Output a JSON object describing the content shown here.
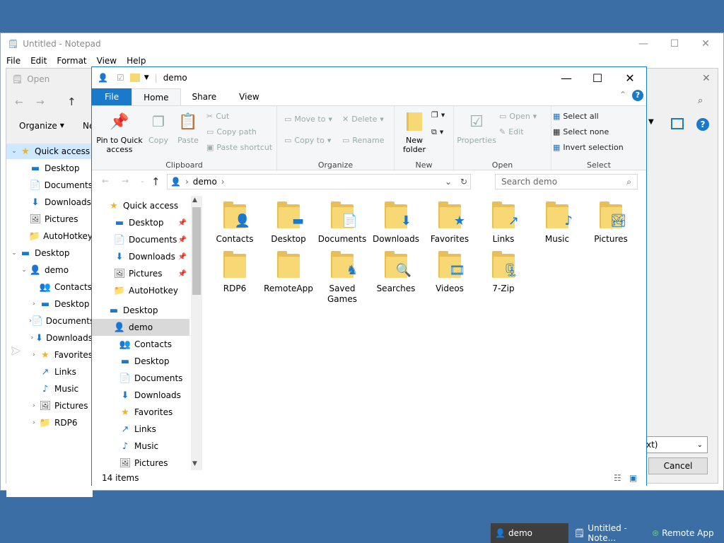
{
  "notepad": {
    "title": "Untitled - Notepad",
    "menu": [
      "File",
      "Edit",
      "Format",
      "View",
      "Help"
    ]
  },
  "open_dialog": {
    "title": "Open",
    "organize": "Organize",
    "new": "Ne",
    "file_type": "xt)",
    "cancel": "Cancel",
    "tree": [
      {
        "label": "Quick access",
        "icon": "star-icon",
        "level": 0,
        "expanded": true,
        "selected": true
      },
      {
        "label": "Desktop",
        "icon": "desktop-icon",
        "level": 1
      },
      {
        "label": "Documents",
        "icon": "documents-icon",
        "level": 1
      },
      {
        "label": "Downloads",
        "icon": "download-icon",
        "level": 1
      },
      {
        "label": "Pictures",
        "icon": "pictures-icon",
        "level": 1
      },
      {
        "label": "AutoHotkey",
        "icon": "folder-icon",
        "level": 1
      },
      {
        "label": "Desktop",
        "icon": "desktop-icon",
        "level": 0,
        "expanded": true
      },
      {
        "label": "demo",
        "icon": "user-icon",
        "level": 1,
        "expanded": true
      },
      {
        "label": "Contacts",
        "icon": "contacts-icon",
        "level": 2
      },
      {
        "label": "Desktop",
        "icon": "desktop-icon",
        "level": 2,
        "collapsed": true
      },
      {
        "label": "Documents",
        "icon": "documents-icon",
        "level": 2,
        "collapsed": true
      },
      {
        "label": "Downloads",
        "icon": "download-icon",
        "level": 2,
        "collapsed": true
      },
      {
        "label": "Favorites",
        "icon": "star-icon",
        "level": 2,
        "collapsed": true
      },
      {
        "label": "Links",
        "icon": "links-icon",
        "level": 2
      },
      {
        "label": "Music",
        "icon": "music-icon",
        "level": 2
      },
      {
        "label": "Pictures",
        "icon": "pictures-icon",
        "level": 2,
        "collapsed": true
      },
      {
        "label": "RDP6",
        "icon": "folder-icon",
        "level": 2,
        "collapsed": true
      }
    ]
  },
  "explorer": {
    "title": "demo",
    "tabs": [
      "File",
      "Home",
      "Share",
      "View"
    ],
    "ribbon": {
      "clipboard": {
        "label": "Clipboard",
        "pin": "Pin to Quick access",
        "copy": "Copy",
        "paste": "Paste",
        "cut": "Cut",
        "copy_path": "Copy path",
        "paste_shortcut": "Paste shortcut"
      },
      "organize": {
        "label": "Organize",
        "move_to": "Move to",
        "copy_to": "Copy to",
        "delete": "Delete",
        "rename": "Rename"
      },
      "new": {
        "label": "New",
        "new_folder": "New folder"
      },
      "open": {
        "label": "Open",
        "properties": "Properties",
        "open": "Open",
        "edit": "Edit"
      },
      "select": {
        "label": "Select",
        "select_all": "Select all",
        "select_none": "Select none",
        "invert": "Invert selection"
      }
    },
    "address": {
      "path": "demo",
      "search_placeholder": "Search demo"
    },
    "nav": [
      {
        "label": "Quick access",
        "icon": "star-icon",
        "level": 0
      },
      {
        "label": "Desktop",
        "icon": "desktop-icon",
        "level": 1,
        "pinned": true
      },
      {
        "label": "Documents",
        "icon": "documents-icon",
        "level": 1,
        "pinned": true
      },
      {
        "label": "Downloads",
        "icon": "download-icon",
        "level": 1,
        "pinned": true
      },
      {
        "label": "Pictures",
        "icon": "pictures-icon",
        "level": 1,
        "pinned": true
      },
      {
        "label": "AutoHotkey",
        "icon": "folder-icon",
        "level": 1
      },
      {
        "label": "Desktop",
        "icon": "desktop-icon",
        "level": 0
      },
      {
        "label": "demo",
        "icon": "user-icon",
        "level": 1,
        "selected": true
      },
      {
        "label": "Contacts",
        "icon": "contacts-icon",
        "level": 2
      },
      {
        "label": "Desktop",
        "icon": "desktop-icon",
        "level": 2
      },
      {
        "label": "Documents",
        "icon": "documents-icon",
        "level": 2
      },
      {
        "label": "Downloads",
        "icon": "download-icon",
        "level": 2
      },
      {
        "label": "Favorites",
        "icon": "star-icon",
        "level": 2
      },
      {
        "label": "Links",
        "icon": "links-icon",
        "level": 2
      },
      {
        "label": "Music",
        "icon": "music-icon",
        "level": 2
      },
      {
        "label": "Pictures",
        "icon": "pictures-icon",
        "level": 2
      }
    ],
    "items": [
      {
        "label": "Contacts",
        "badge": "👤",
        "icon": "contacts-folder-icon"
      },
      {
        "label": "Desktop",
        "badge": "▬",
        "icon": "desktop-folder-icon"
      },
      {
        "label": "Documents",
        "badge": "📄",
        "icon": "documents-folder-icon"
      },
      {
        "label": "Downloads",
        "badge": "⬇",
        "icon": "downloads-folder-icon"
      },
      {
        "label": "Favorites",
        "badge": "★",
        "icon": "favorites-folder-icon"
      },
      {
        "label": "Links",
        "badge": "↗",
        "icon": "links-folder-icon"
      },
      {
        "label": "Music",
        "badge": "♪",
        "icon": "music-folder-icon"
      },
      {
        "label": "Pictures",
        "badge": "🏞",
        "icon": "pictures-folder-icon"
      },
      {
        "label": "RDP6",
        "badge": "",
        "icon": "folder-icon"
      },
      {
        "label": "RemoteApp",
        "badge": "",
        "icon": "folder-icon"
      },
      {
        "label": "Saved Games",
        "badge": "♞",
        "icon": "saved-games-folder-icon"
      },
      {
        "label": "Searches",
        "badge": "🔍",
        "icon": "searches-folder-icon"
      },
      {
        "label": "Videos",
        "badge": "🎞",
        "icon": "videos-folder-icon"
      },
      {
        "label": "7-Zip",
        "badge": "🗜",
        "icon": "zip-folder-icon"
      }
    ],
    "status": "14 items"
  },
  "taskbar": [
    {
      "label": "demo",
      "icon": "user-icon"
    },
    {
      "label": "Untitled - Note...",
      "icon": "notepad-icon"
    },
    {
      "label": "Remote App",
      "icon": "remoteapp-icon"
    }
  ],
  "colors": {
    "accent": "#1979ca",
    "desktop": "#3a6ea5",
    "folder": "#f8d775"
  }
}
